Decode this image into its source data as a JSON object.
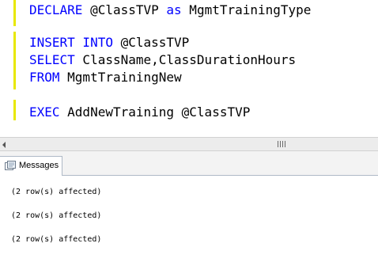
{
  "editor": {
    "line1": {
      "kw1": "DECLARE",
      "text1": " @ClassTVP ",
      "kw2": "as",
      "text2": " MgmtTrainingType"
    },
    "line2": {
      "kw1": "INSERT INTO",
      "text1": " @ClassTVP"
    },
    "line3": {
      "kw1": "SELECT",
      "text1": " ClassName,ClassDurationHours"
    },
    "line4": {
      "kw1": "FROM",
      "text1": " MgmtTrainingNew"
    },
    "line5": {
      "kw1": "EXEC",
      "text1": " AddNewTraining @ClassTVP"
    }
  },
  "results": {
    "tab_label": "Messages",
    "messages": [
      "(2 row(s) affected)",
      "(2 row(s) affected)",
      "(2 row(s) affected)"
    ]
  },
  "colors": {
    "keyword": "#0000ff",
    "margin_marker": "#e8e800"
  },
  "icons": {
    "tab_icon": "messages-icon",
    "scroll_left": "scroll-left-arrow-icon",
    "scroll_grip": "scroll-grip-icon"
  }
}
